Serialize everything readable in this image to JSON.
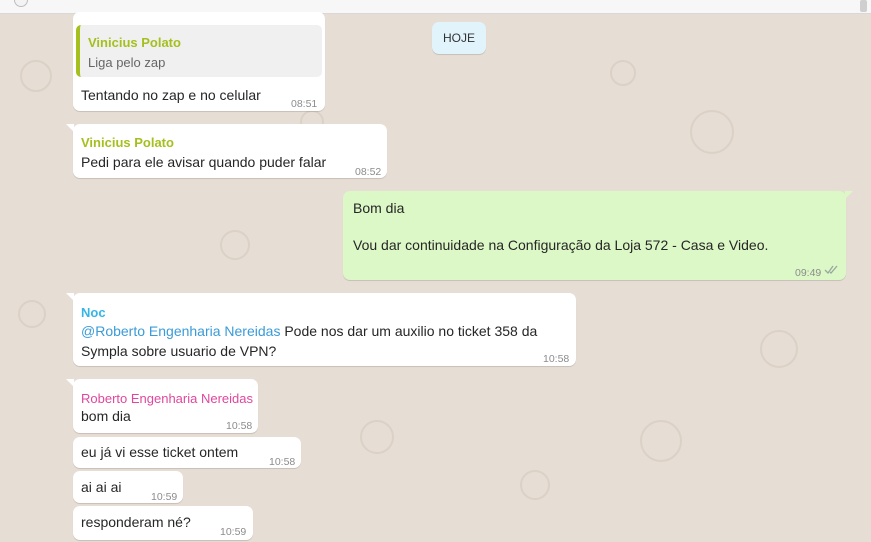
{
  "date_badge": "HOJE",
  "colors": {
    "background": "#e6ddd4",
    "incoming": "#ffffff",
    "outgoing": "#dcf8c6",
    "vinicius": "#a5bf1e",
    "noc": "#35b6e6",
    "roberto": "#e0479e",
    "mention": "#3a9bd8"
  },
  "messages": [
    {
      "quote_author": "Vinicius Polato",
      "quote_text": "Liga pelo zap",
      "text": "Tentando no zap e no celular",
      "time": "08:51"
    },
    {
      "sender": "Vinicius Polato",
      "text": "Pedi para ele avisar quando puder falar",
      "time": "08:52"
    },
    {
      "line1": "Bom dia",
      "line2": "Vou dar continuidade na Configuração da Loja 572 - Casa e Video.",
      "time": "09:49",
      "status_icon": "double-check-icon"
    },
    {
      "sender": "Noc",
      "mention": "@Roberto Engenharia Nereidas",
      "text_line1": " Pode nos dar um auxilio no ticket 358 da",
      "text_line2": "Sympla sobre usuario de VPN?",
      "time": "10:58"
    },
    {
      "sender": "Roberto Engenharia Nereidas",
      "text": "bom dia",
      "time": "10:58"
    },
    {
      "text": "eu já vi esse ticket ontem",
      "time": "10:58"
    },
    {
      "text": "ai ai ai",
      "time": "10:59"
    },
    {
      "text": "responderam né?",
      "time": "10:59"
    }
  ]
}
